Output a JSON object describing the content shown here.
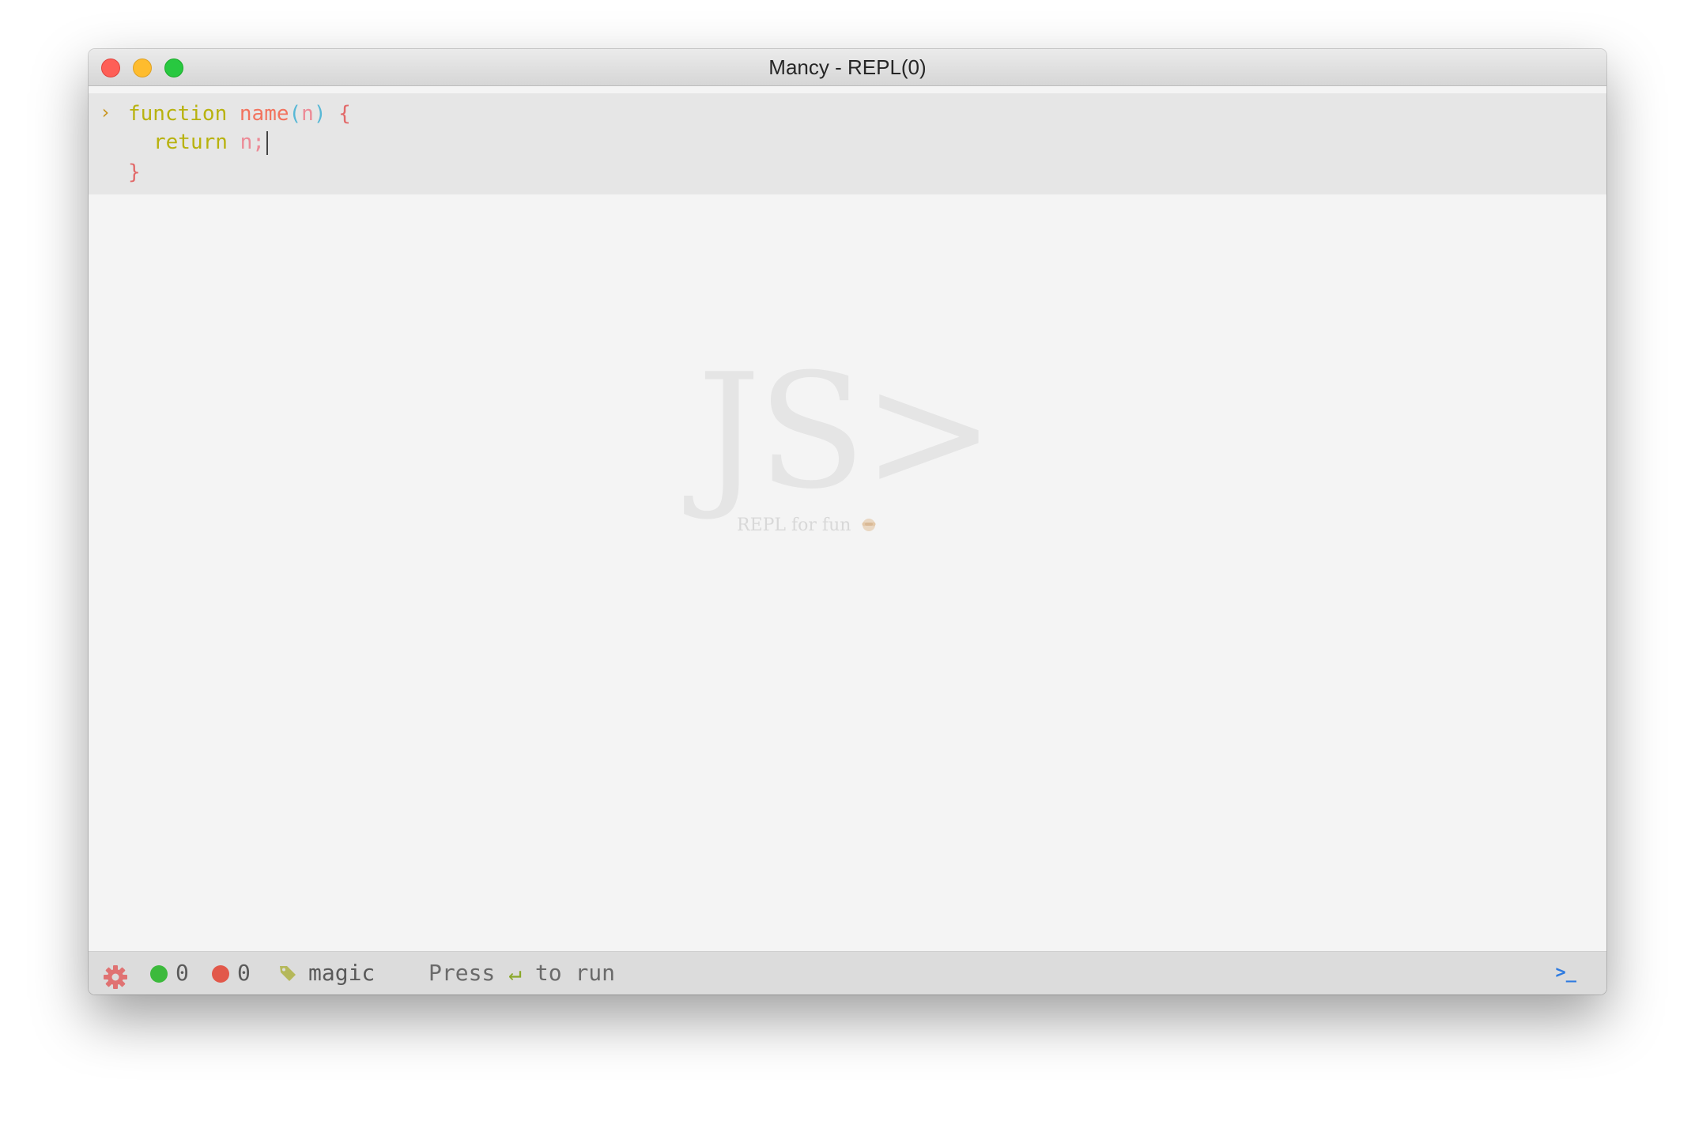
{
  "window": {
    "title": "Mancy - REPL(0)"
  },
  "editor": {
    "prompt": "›",
    "lines": {
      "l1": {
        "kw": "function",
        "fn": "name",
        "paren_open": "(",
        "param": "n",
        "paren_close": ")",
        "brace": "{"
      },
      "l2": {
        "kw": "return",
        "value": "n;"
      },
      "l3": {
        "brace": "}"
      }
    }
  },
  "watermark": {
    "logo": "JS>",
    "tagline": "REPL for fun"
  },
  "statusbar": {
    "success_count": "0",
    "error_count": "0",
    "mode": "magic",
    "hint_prefix": "Press",
    "hint_key": "↵",
    "hint_suffix": "to run",
    "terminal_label": ">_"
  },
  "colors": {
    "keyword": "#b8b20e",
    "function_name": "#f2735e",
    "paren": "#58b8d6",
    "param": "#ec8a96",
    "brace": "#e26a6a",
    "success": "#3cba3c",
    "error": "#e2584a",
    "terminal": "#2f7be0"
  },
  "icons": {
    "settings": "gear-icon",
    "tag": "tag-icon",
    "terminal": "terminal-icon"
  }
}
